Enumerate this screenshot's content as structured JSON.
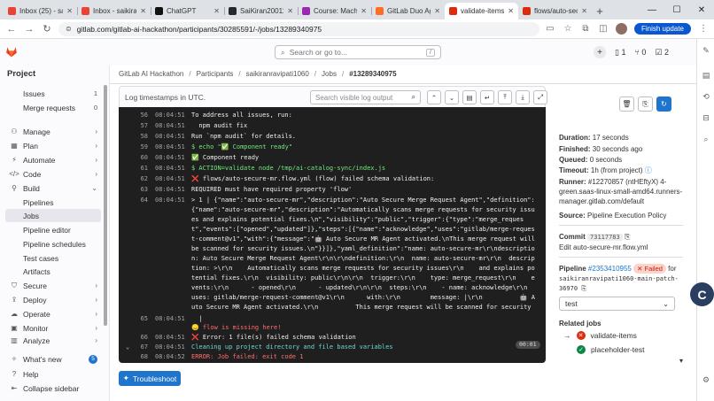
{
  "browser": {
    "tabs": [
      {
        "label": "Inbox (25) - sai",
        "color": "#ea4335"
      },
      {
        "label": "Inbox - saikiran",
        "color": "#ea4335"
      },
      {
        "label": "ChatGPT",
        "color": "#111111"
      },
      {
        "label": "SaiKiran20011(",
        "color": "#24292f"
      },
      {
        "label": "Course: Machin",
        "color": "#9c27b0"
      },
      {
        "label": "GitLab Duo Age",
        "color": "#fc6d26"
      },
      {
        "label": "validate-items",
        "color": "#dd2b0e"
      },
      {
        "label": "flows/auto-secu",
        "color": "#dd2b0e"
      }
    ],
    "url": "gitlab.com/gitlab-ai-hackathon/participants/30285591/-/jobs/13289340975",
    "finish_update_label": "Finish update"
  },
  "header": {
    "search_placeholder": "Search or go to...",
    "search_shortcut": "/",
    "issues_count": "1",
    "mr_count": "0",
    "todo_count": "2"
  },
  "sidebar": {
    "project_label": "Project",
    "items": [
      {
        "label": "Issues",
        "count": "1"
      },
      {
        "label": "Merge requests",
        "count": "0"
      },
      {
        "label": "Manage"
      },
      {
        "label": "Plan"
      },
      {
        "label": "Automate"
      },
      {
        "label": "Code"
      },
      {
        "label": "Build"
      },
      {
        "label": "Pipelines"
      },
      {
        "label": "Jobs"
      },
      {
        "label": "Pipeline editor"
      },
      {
        "label": "Pipeline schedules"
      },
      {
        "label": "Test cases"
      },
      {
        "label": "Artifacts"
      },
      {
        "label": "Secure"
      },
      {
        "label": "Deploy"
      },
      {
        "label": "Operate"
      },
      {
        "label": "Monitor"
      },
      {
        "label": "Analyze"
      },
      {
        "label": "What's new",
        "count": "5"
      },
      {
        "label": "Help"
      },
      {
        "label": "Collapse sidebar"
      }
    ]
  },
  "breadcrumb": [
    "GitLab AI Hackathon",
    "Participants",
    "saikiranravipati1060",
    "Jobs",
    "#13289340975"
  ],
  "log": {
    "header": "Log timestamps in UTC.",
    "search_placeholder": "Search visible log output",
    "duration": "00:01",
    "lines": [
      {
        "n": "56",
        "t": "08:04:51",
        "x": "To address all issues, run:"
      },
      {
        "n": "57",
        "t": "08:04:51",
        "x": "  npm audit fix"
      },
      {
        "n": "58",
        "t": "08:04:51",
        "x": "Run `npm audit` for details."
      },
      {
        "n": "59",
        "t": "08:04:51",
        "x": "$ echo \"✅ Component ready\""
      },
      {
        "n": "60",
        "t": "08:04:51",
        "x": "✅ Component ready"
      },
      {
        "n": "61",
        "t": "08:04:51",
        "x": "$ ACTION=validate node /tmp/ai-catalog-sync/index.js"
      },
      {
        "n": "62",
        "t": "08:04:51",
        "x": "❌ flows/auto-secure-mr.flow.yml (flow) failed schema validation:"
      },
      {
        "n": "63",
        "t": "08:04:51",
        "x": "REQUIRED must have required property 'flow'"
      },
      {
        "n": "64",
        "t": "08:04:51",
        "x": "> 1 | {\"name\":\"auto-secure-mr\",\"description\":\"Auto Secure Merge Request Agent\",\"definition\":{\"name\":\"auto-secure-mr\",\"description\":\"Automatically scans merge requests for security issues and explains potential fixes.\\n\",\"visibility\":\"public\",\"trigger\":{\"type\":\"merge_request\",\"events\":[\"opened\",\"updated\"]},\"steps\":[{\"name\":\"acknowledge\",\"uses\":\"gitlab/merge-request-comment@v1\",\"with\":{\"message\":\"🤖 Auto Secure MR Agent activated.\\nThis merge request will be scanned for security issues.\\n\"}}]},\"yaml_definition\":\"name: auto-secure-mr\\r\\ndescription: Auto Secure Merge Request Agent\\r\\n\\r\\ndefinition:\\r\\n  name: auto-secure-mr\\r\\n  description: >\\r\\n    Automatically scans merge requests for security issues\\r\\n    and explains potential fixes.\\r\\n  visibility: public\\r\\n\\r\\n  trigger:\\r\\n    type: merge_request\\r\\n    events:\\r\\n      - opened\\r\\n      - updated\\r\\n\\r\\n  steps:\\r\\n    - name: acknowledge\\r\\n      uses: gitlab/merge-request-comment@v1\\r\\n      with:\\r\\n        message: |\\r\\n          🤖 Auto Secure MR Agent activated.\\r\\n          This merge request will be scanned for security issues.\\r\\n\\r\\nconsumers: []\",\"consumers\":[]}"
      },
      {
        "n": "65",
        "t": "08:04:51",
        "x": "  |"
      },
      {
        "n": "",
        "t": "",
        "x": "😞 flow is missing here!"
      },
      {
        "n": "66",
        "t": "08:04:51",
        "x": "❌ Error: 1 file(s) failed schema validation"
      },
      {
        "n": "67",
        "t": "08:04:51",
        "x": "Cleaning up project directory and file based variables"
      },
      {
        "n": "68",
        "t": "08:04:52",
        "x": "ERROR: Job failed: exit code 1"
      }
    ]
  },
  "troubleshoot_label": "Troubleshoot",
  "job": {
    "duration_label": "Duration:",
    "duration": "17 seconds",
    "finished_label": "Finished:",
    "finished": "30 seconds ago",
    "queued_label": "Queued:",
    "queued": "0 seconds",
    "timeout_label": "Timeout:",
    "timeout": "1h (from project)",
    "runner_label": "Runner:",
    "runner": "#12270857 (ntHEftyX) 4-green.saas-linux-small-amd64.runners-manager.gitlab.com/default",
    "source_label": "Source:",
    "source": "Pipeline Execution Policy",
    "commit_label": "Commit",
    "commit_sha": "73117783",
    "commit_message": "Edit auto-secure-mr.flow.yml",
    "pipeline_label": "Pipeline",
    "pipeline_id": "#2353410955",
    "pipeline_status": "Failed",
    "pipeline_for": "for",
    "pipeline_ref": "saikiranravipati1060-main-patch-36970",
    "stage": "test",
    "related_jobs_label": "Related jobs",
    "related_jobs": [
      {
        "name": "validate-items",
        "status": "failed"
      },
      {
        "name": "placeholder-test",
        "status": "passed"
      }
    ]
  }
}
